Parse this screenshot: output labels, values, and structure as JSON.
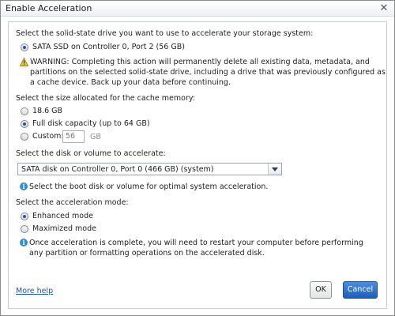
{
  "window": {
    "title": "Enable Acceleration",
    "close_glyph": "✕"
  },
  "ssd_section": {
    "prompt": "Select the solid-state drive you want to use to accelerate your storage system:",
    "option": "SATA SSD on Controller 0, Port 2 (56 GB)",
    "warning": "WARNING: Completing this action will permanently delete all existing data, metadata, and partitions on the selected solid-state drive, including a drive that was previously configured as a cache device. Back up your data before continuing."
  },
  "cache_section": {
    "prompt": "Select the size allocated for the cache memory:",
    "options": [
      "18.6 GB",
      "Full disk capacity (up to 64 GB)",
      "Custom:"
    ],
    "selected_index": 1,
    "custom_value": "56",
    "custom_unit": "GB"
  },
  "disk_section": {
    "prompt": "Select the disk or volume to accelerate:",
    "selected": "SATA disk on Controller 0, Port 0 (466 GB) (system)",
    "info": "Select the boot disk or volume for optimal system acceleration."
  },
  "mode_section": {
    "prompt": "Select the acceleration mode:",
    "options": [
      "Enhanced mode",
      "Maximized mode"
    ],
    "selected_index": 0,
    "info": "Once acceleration is complete, you will need to restart your computer before performing any partition or formatting operations on the accelerated disk."
  },
  "footer": {
    "help_link": "More help",
    "ok_label": "OK",
    "cancel_label": "Cancel"
  },
  "icons": {
    "warning": "warning-triangle-icon",
    "info": "info-circle-icon",
    "info_glyph": "i"
  },
  "colors": {
    "accent": "#1b57b6",
    "warning_fill": "#f2c318",
    "info_fill": "#2f8fd6",
    "cancel_button": "#1c5fb8"
  }
}
